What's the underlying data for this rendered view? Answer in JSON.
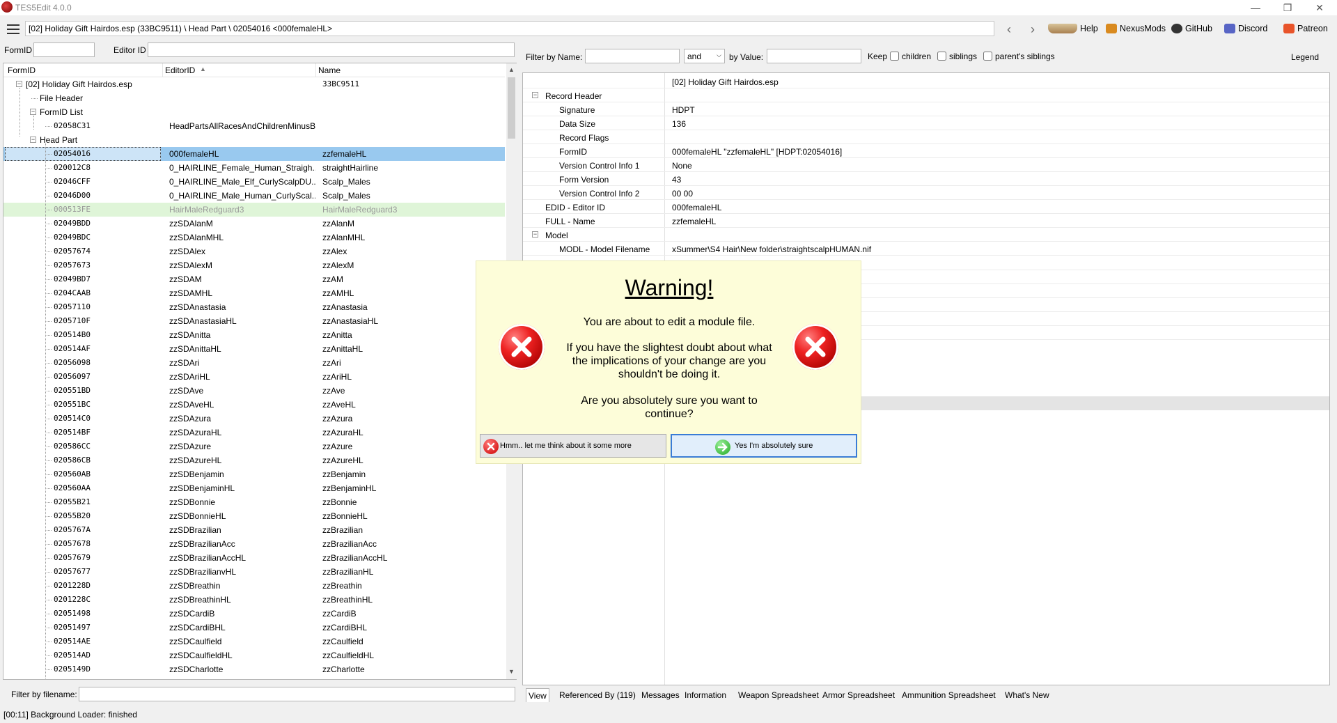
{
  "window": {
    "title": "TES5Edit 4.0.0",
    "path": "[02] Holiday Gift Hairdos.esp (33BC9511) \\ Head Part \\ 02054016 <000femaleHL>"
  },
  "toolbar": {
    "help": "Help",
    "nexus": "NexusMods",
    "github": "GitHub",
    "discord": "Discord",
    "patreon": "Patreon"
  },
  "left": {
    "formid_label": "FormID",
    "editorid_label": "Editor ID",
    "columns": {
      "formid": "FormID",
      "editorid": "EditorID",
      "name": "Name"
    },
    "filter_filename_label": "Filter by filename:",
    "tree": [
      {
        "id": "[02] Holiday Gift Hairdos.esp",
        "eid": "",
        "name": "33BC9511",
        "level": 0,
        "type": "root"
      },
      {
        "id": "File Header",
        "eid": "",
        "name": "",
        "level": 1,
        "type": "node"
      },
      {
        "id": "FormID List",
        "eid": "",
        "name": "",
        "level": 1,
        "type": "group"
      },
      {
        "id": "02058C31",
        "eid": "HeadPartsAllRacesAndChildrenMinusBeast",
        "name": "",
        "level": 2,
        "type": "rec"
      },
      {
        "id": "Head Part",
        "eid": "",
        "name": "",
        "level": 1,
        "type": "group"
      },
      {
        "id": "02054016",
        "eid": "000femaleHL",
        "name": "zzfemaleHL",
        "level": 2,
        "type": "sel"
      },
      {
        "id": "020012C8",
        "eid": "0_HAIRLINE_Female_Human_Straigh...",
        "name": "straightHairline",
        "level": 2,
        "type": "rec"
      },
      {
        "id": "02046CFF",
        "eid": "0_HAIRLINE_Male_Elf_CurlyScalpDU...",
        "name": "Scalp_Males",
        "level": 2,
        "type": "rec"
      },
      {
        "id": "02046D00",
        "eid": "0_HAIRLINE_Male_Human_CurlyScal...",
        "name": "Scalp_Males",
        "level": 2,
        "type": "rec"
      },
      {
        "id": "000513FE",
        "eid": "HairMaleRedguard3",
        "name": "HairMaleRedguard3",
        "level": 2,
        "type": "green"
      },
      {
        "id": "02049BDD",
        "eid": "zzSDAlanM",
        "name": "zzAlanM",
        "level": 2,
        "type": "rec"
      },
      {
        "id": "02049BDC",
        "eid": "zzSDAlanMHL",
        "name": "zzAlanMHL",
        "level": 2,
        "type": "rec"
      },
      {
        "id": "02057674",
        "eid": "zzSDAlex",
        "name": "zzAlex",
        "level": 2,
        "type": "rec"
      },
      {
        "id": "02057673",
        "eid": "zzSDAlexM",
        "name": "zzAlexM",
        "level": 2,
        "type": "rec"
      },
      {
        "id": "02049BD7",
        "eid": "zzSDAM",
        "name": "zzAM",
        "level": 2,
        "type": "rec"
      },
      {
        "id": "0204CAAB",
        "eid": "zzSDAMHL",
        "name": "zzAMHL",
        "level": 2,
        "type": "rec"
      },
      {
        "id": "02057110",
        "eid": "zzSDAnastasia",
        "name": "zzAnastasia",
        "level": 2,
        "type": "rec"
      },
      {
        "id": "0205710F",
        "eid": "zzSDAnastasiaHL",
        "name": "zzAnastasiaHL",
        "level": 2,
        "type": "rec"
      },
      {
        "id": "020514B0",
        "eid": "zzSDAnitta",
        "name": "zzAnitta",
        "level": 2,
        "type": "rec"
      },
      {
        "id": "020514AF",
        "eid": "zzSDAnittaHL",
        "name": "zzAnittaHL",
        "level": 2,
        "type": "rec"
      },
      {
        "id": "02056098",
        "eid": "zzSDAri",
        "name": "zzAri",
        "level": 2,
        "type": "rec"
      },
      {
        "id": "02056097",
        "eid": "zzSDAriHL",
        "name": "zzAriHL",
        "level": 2,
        "type": "rec"
      },
      {
        "id": "020551BD",
        "eid": "zzSDAve",
        "name": "zzAve",
        "level": 2,
        "type": "rec"
      },
      {
        "id": "020551BC",
        "eid": "zzSDAveHL",
        "name": "zzAveHL",
        "level": 2,
        "type": "rec"
      },
      {
        "id": "020514C0",
        "eid": "zzSDAzura",
        "name": "zzAzura",
        "level": 2,
        "type": "rec"
      },
      {
        "id": "020514BF",
        "eid": "zzSDAzuraHL",
        "name": "zzAzuraHL",
        "level": 2,
        "type": "rec"
      },
      {
        "id": "020586CC",
        "eid": "zzSDAzure",
        "name": "zzAzure",
        "level": 2,
        "type": "rec"
      },
      {
        "id": "020586CB",
        "eid": "zzSDAzureHL",
        "name": "zzAzureHL",
        "level": 2,
        "type": "rec"
      },
      {
        "id": "020560AB",
        "eid": "zzSDBenjamin",
        "name": "zzBenjamin",
        "level": 2,
        "type": "rec"
      },
      {
        "id": "020560AA",
        "eid": "zzSDBenjaminHL",
        "name": "zzBenjaminHL",
        "level": 2,
        "type": "rec"
      },
      {
        "id": "02055B21",
        "eid": "zzSDBonnie",
        "name": "zzBonnie",
        "level": 2,
        "type": "rec"
      },
      {
        "id": "02055B20",
        "eid": "zzSDBonnieHL",
        "name": "zzBonnieHL",
        "level": 2,
        "type": "rec"
      },
      {
        "id": "0205767A",
        "eid": "zzSDBrazilian",
        "name": "zzBrazilian",
        "level": 2,
        "type": "rec"
      },
      {
        "id": "02057678",
        "eid": "zzSDBrazilianAcc",
        "name": "zzBrazilianAcc",
        "level": 2,
        "type": "rec"
      },
      {
        "id": "02057679",
        "eid": "zzSDBrazilianAccHL",
        "name": "zzBrazilianAccHL",
        "level": 2,
        "type": "rec"
      },
      {
        "id": "02057677",
        "eid": "zzSDBrazilianvHL",
        "name": "zzBrazilianHL",
        "level": 2,
        "type": "rec"
      },
      {
        "id": "0201228D",
        "eid": "zzSDBreathin",
        "name": "zzBreathin",
        "level": 2,
        "type": "rec"
      },
      {
        "id": "0201228C",
        "eid": "zzSDBreathinHL",
        "name": "zzBreathinHL",
        "level": 2,
        "type": "rec"
      },
      {
        "id": "02051498",
        "eid": "zzSDCardiB",
        "name": "zzCardiB",
        "level": 2,
        "type": "rec"
      },
      {
        "id": "02051497",
        "eid": "zzSDCardiBHL",
        "name": "zzCardiBHL",
        "level": 2,
        "type": "rec"
      },
      {
        "id": "020514AE",
        "eid": "zzSDCaulfield",
        "name": "zzCaulfield",
        "level": 2,
        "type": "rec"
      },
      {
        "id": "020514AD",
        "eid": "zzSDCaulfieldHL",
        "name": "zzCaulfieldHL",
        "level": 2,
        "type": "rec"
      },
      {
        "id": "0205149D",
        "eid": "zzSDCharlotte",
        "name": "zzCharlotte",
        "level": 2,
        "type": "rec"
      }
    ]
  },
  "right": {
    "filter_name_label": "Filter by Name:",
    "and_option": "and",
    "by_value_label": "by Value:",
    "keep_label": "Keep",
    "children_label": "children",
    "siblings_label": "siblings",
    "parents_siblings_label": "parent's siblings",
    "legend_label": "Legend",
    "header_value": "[02] Holiday Gift Hairdos.esp",
    "rows": [
      {
        "k": "Record Header",
        "v": "",
        "indent": 1,
        "exp": true
      },
      {
        "k": "Signature",
        "v": "HDPT",
        "indent": 2
      },
      {
        "k": "Data Size",
        "v": "136",
        "indent": 2
      },
      {
        "k": "Record Flags",
        "v": "",
        "indent": 2
      },
      {
        "k": "FormID",
        "v": "000femaleHL \"zzfemaleHL\" [HDPT:02054016]",
        "indent": 2
      },
      {
        "k": "Version Control Info 1",
        "v": "None",
        "indent": 2
      },
      {
        "k": "Form Version",
        "v": "43",
        "indent": 2
      },
      {
        "k": "Version Control Info 2",
        "v": "00 00",
        "indent": 2
      },
      {
        "k": "EDID - Editor ID",
        "v": "000femaleHL",
        "indent": 1
      },
      {
        "k": "FULL - Name",
        "v": "zzfemaleHL",
        "indent": 1
      },
      {
        "k": "Model",
        "v": "",
        "indent": 1,
        "exp": true
      },
      {
        "k": "MODL - Model Filename",
        "v": "xSummer\\S4 Hair\\New folder\\straightscalpHUMAN.nif",
        "indent": 2
      }
    ]
  },
  "tabs": [
    "View",
    "Referenced By (119)",
    "Messages",
    "Information",
    "Weapon Spreadsheet",
    "Armor Spreadsheet",
    "Ammunition Spreadsheet",
    "What's New"
  ],
  "status": "[00:11] Background Loader: finished",
  "dialog": {
    "title": "Warning!",
    "line1": "You are about to edit a module file.",
    "line2": "If you have the slightest doubt about what the implications of your change are you shouldn't be doing it.",
    "line3": "Are you absolutely sure you want to continue?",
    "btn_no": "Hmm.. let me think about it some more",
    "btn_yes": "Yes I'm absolutely sure"
  }
}
